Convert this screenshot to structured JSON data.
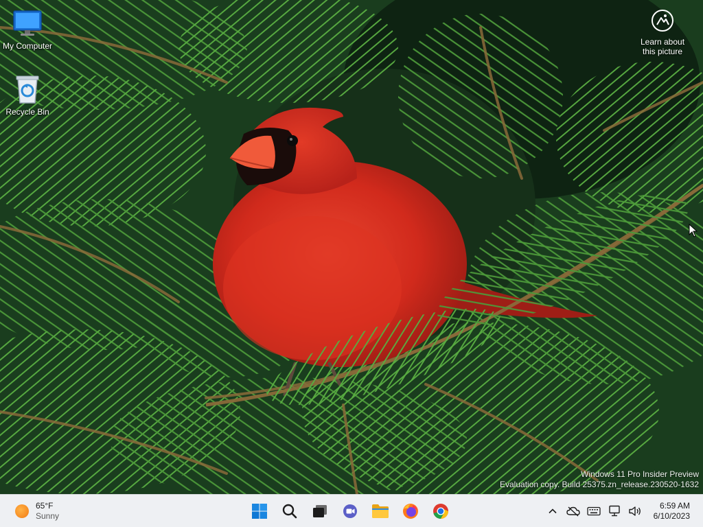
{
  "desktop": {
    "icons": [
      {
        "label": "My Computer",
        "icon": "monitor-icon"
      },
      {
        "label": "Recycle Bin",
        "icon": "recycle-bin-icon"
      }
    ],
    "spotlight": {
      "label_line1": "Learn about",
      "label_line2": "this picture",
      "icon": "camera-icon"
    },
    "watermark": {
      "line1": "Windows 11 Pro Insider Preview",
      "line2": "Evaluation copy. Build 25375.zn_release.230520-1632"
    }
  },
  "taskbar": {
    "weather": {
      "temp": "65°F",
      "condition": "Sunny",
      "icon": "sun-icon"
    },
    "pinned": [
      {
        "name": "start",
        "icon": "windows-logo-icon"
      },
      {
        "name": "search",
        "icon": "search-icon"
      },
      {
        "name": "task-view",
        "icon": "task-view-icon"
      },
      {
        "name": "chat",
        "icon": "chat-icon"
      },
      {
        "name": "file-explorer",
        "icon": "folder-icon"
      },
      {
        "name": "firefox",
        "icon": "firefox-icon"
      },
      {
        "name": "chrome",
        "icon": "chrome-icon"
      }
    ],
    "tray": {
      "icons": [
        "chevron-up-icon",
        "cloud-off-icon",
        "keyboard-icon",
        "network-icon",
        "volume-icon"
      ],
      "time": "6:59 AM",
      "date": "6/10/2023"
    }
  },
  "colors": {
    "taskbar_bg": "#eef0f3",
    "windows_blue": "#0078d4",
    "cardinal_red": "#d92b1e"
  }
}
